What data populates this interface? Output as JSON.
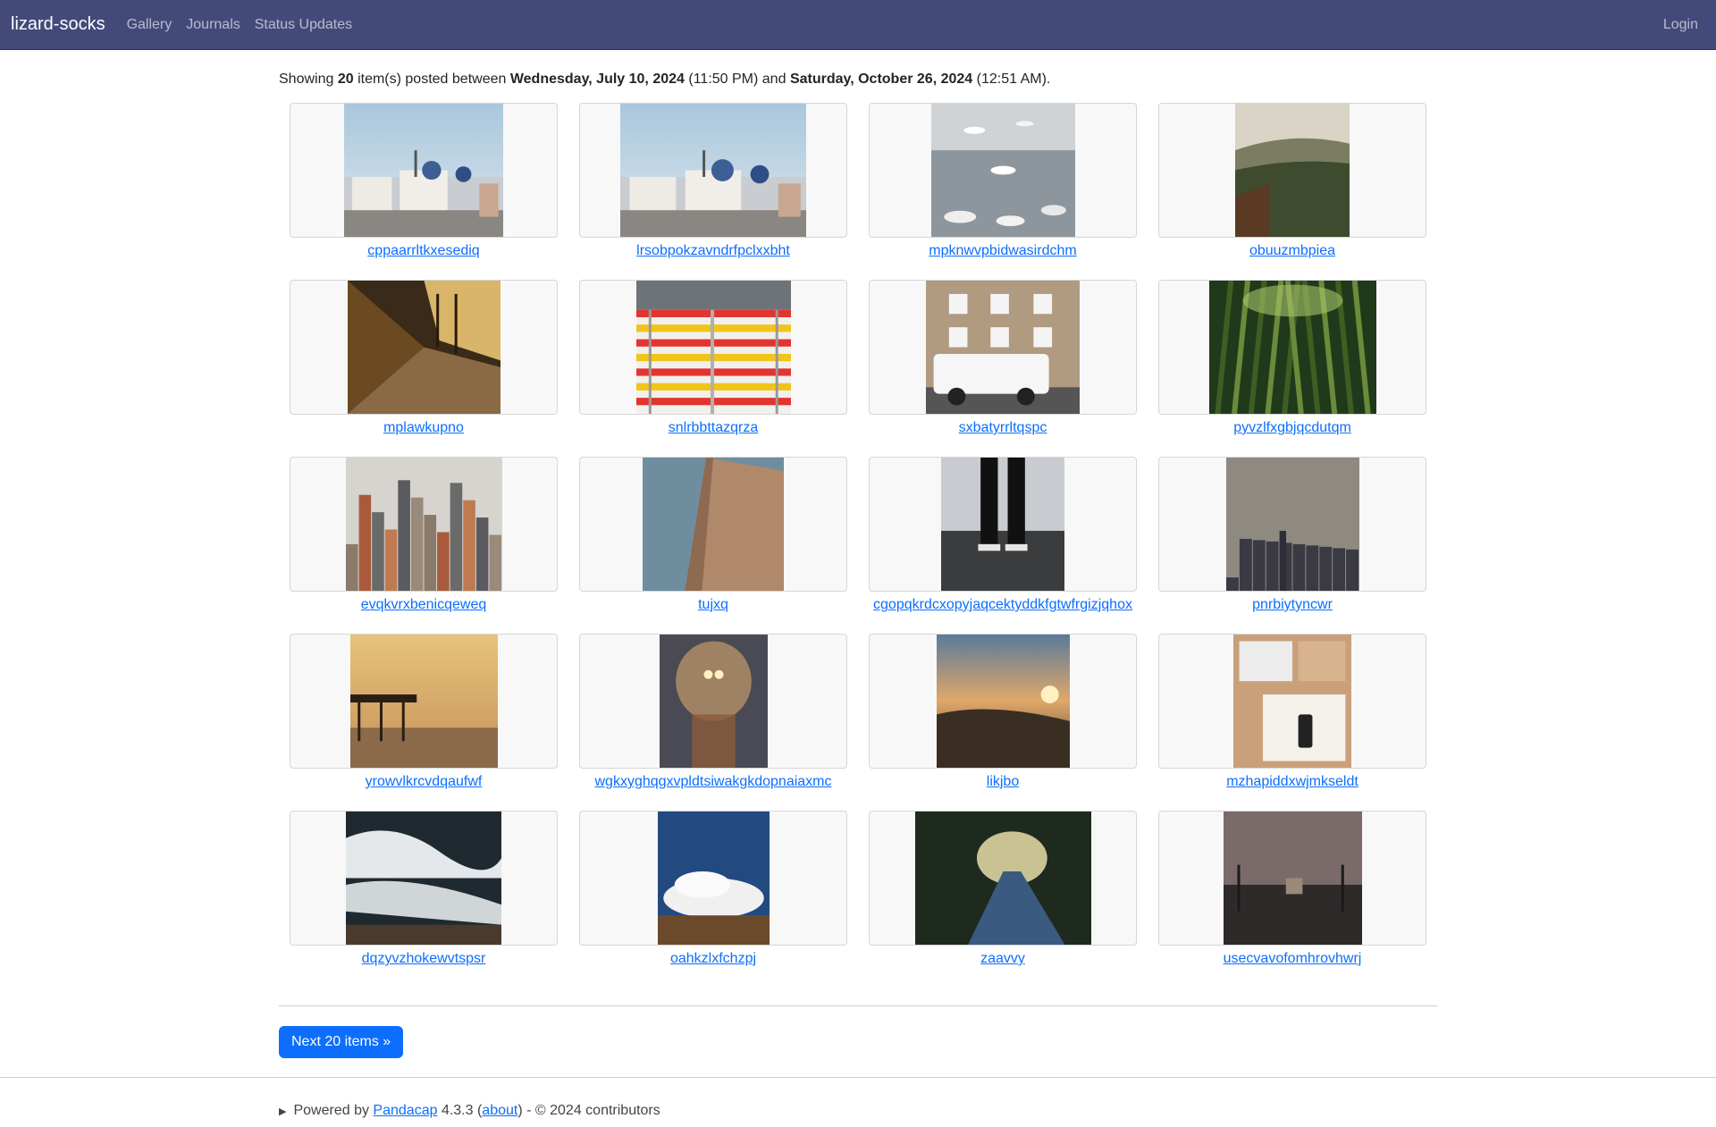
{
  "nav": {
    "brand": "lizard-socks",
    "links": [
      "Gallery",
      "Journals",
      "Status Updates"
    ],
    "login": "Login"
  },
  "summary": {
    "prefix": "Showing",
    "count": "20",
    "middle": "item(s) posted between",
    "start_date": "Wednesday, July 10, 2024",
    "start_time": "(11:50 PM)",
    "and": "and",
    "end_date": "Saturday, October 26, 2024",
    "end_time": "(12:51 AM)."
  },
  "items": [
    {
      "title": "cppaarrltkxesediq",
      "scene": "santorini"
    },
    {
      "title": "lrsobpokzavndrfpclxxbht",
      "scene": "santorini"
    },
    {
      "title": "mpknwvpbidwasirdchm",
      "scene": "seagulls"
    },
    {
      "title": "obuuzmbpiea",
      "scene": "hills"
    },
    {
      "title": "mplawkupno",
      "scene": "hallway"
    },
    {
      "title": "snlrbbttazqrza",
      "scene": "stripes"
    },
    {
      "title": "sxbatyrrltqspc",
      "scene": "house-car"
    },
    {
      "title": "pyvzlfxgbjqcdutqm",
      "scene": "bamboo"
    },
    {
      "title": "evqkvrxbenicqeweq",
      "scene": "city"
    },
    {
      "title": "tujxq",
      "scene": "flatiron"
    },
    {
      "title": "cgopqkrdcxopyjaqcektyddkfgtwfrgizjqhox",
      "scene": "legs"
    },
    {
      "title": "pnrbiytyncwr",
      "scene": "skyline-fog"
    },
    {
      "title": "yrowvlkrcvdqaufwf",
      "scene": "pier"
    },
    {
      "title": "wgkxyghqgxvpldtsiwakgkdopnaiaxmc",
      "scene": "fog-lights"
    },
    {
      "title": "likjbo",
      "scene": "sunrise"
    },
    {
      "title": "mzhapiddxwjmkseldt",
      "scene": "desk"
    },
    {
      "title": "dqzyvzhokewvtspsr",
      "scene": "waves"
    },
    {
      "title": "oahkzlxfchzpj",
      "scene": "clouds"
    },
    {
      "title": "zaavvy",
      "scene": "road"
    },
    {
      "title": "usecvavofomhrovhwrj",
      "scene": "bridge"
    }
  ],
  "pager": {
    "next_label": "Next 20 items »"
  },
  "footer": {
    "powered_by": "Powered by",
    "app_name": "Pandacap",
    "version": "4.3.3 (",
    "about": "about",
    "tail": ") - © 2024 contributors"
  }
}
